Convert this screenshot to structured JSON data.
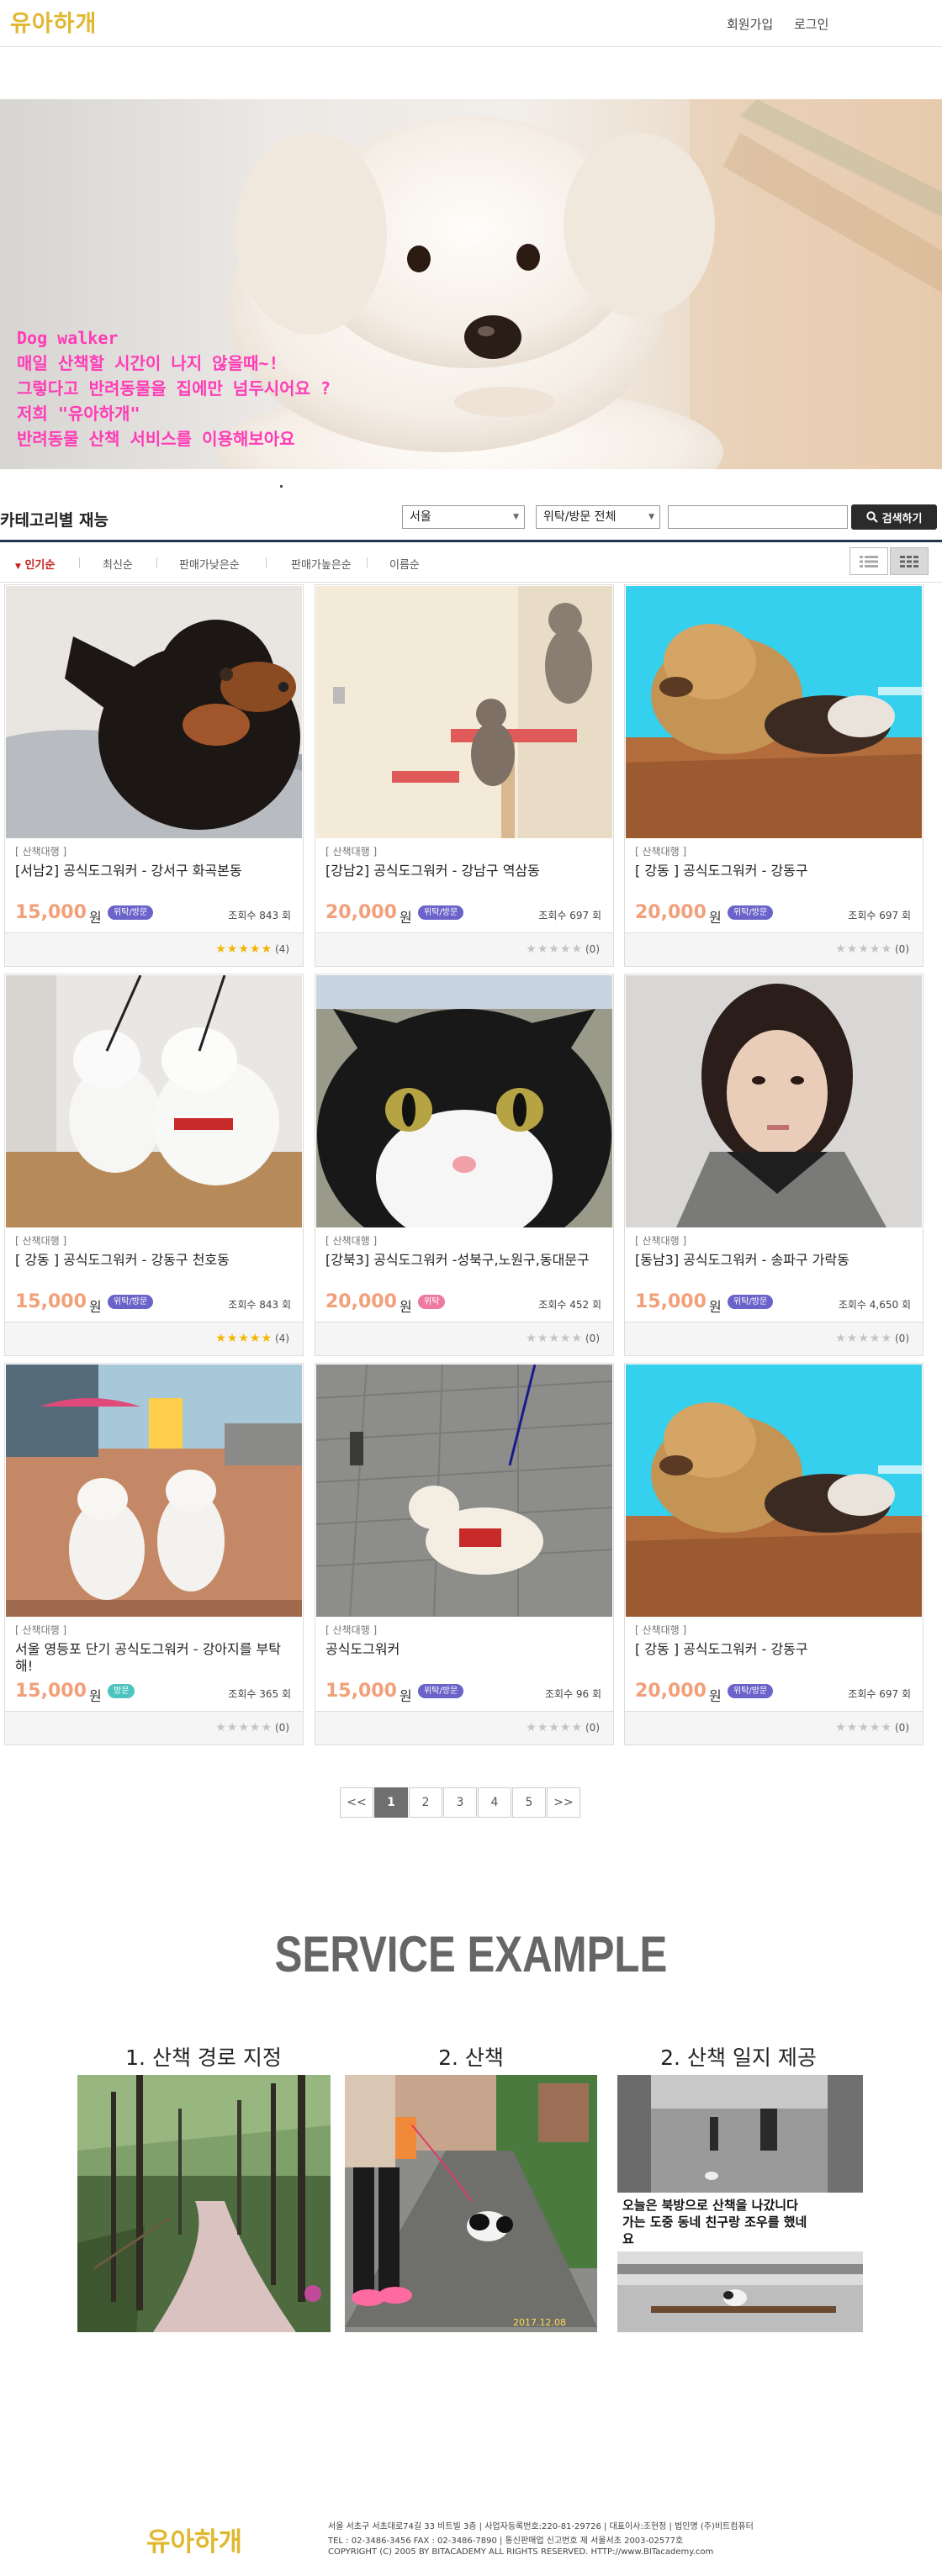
{
  "header": {
    "logo": "유아하개",
    "signup": "회원가입",
    "login": "로그인"
  },
  "hero": {
    "lines": [
      "Dog walker",
      "매일 산책할 시간이 나지 않을때~!",
      "그렇다고 반려동물을 집에만 넘두시어요 ?",
      "저희 \"유아하개\"",
      "반려동물 산책 서비스를 이용해보아요"
    ]
  },
  "category": {
    "title": "카테고리별 재능",
    "region": "서울",
    "type": "위탁/방문 전체",
    "search_placeholder": "",
    "search_button": "검색하기",
    "sorts": [
      "인기순",
      "최신순",
      "판매가낮은순",
      "판매가높은순",
      "이름순"
    ]
  },
  "listings": [
    {
      "tag": "[ 산책대행 ]",
      "title": "[서남2] 공식도그워커 - 강서구 화곡본동",
      "price": "15,000",
      "won": "원",
      "badge": "위탁/방문",
      "views": "조회수 843 회",
      "rating": 5,
      "count": "(4)"
    },
    {
      "tag": "[ 산책대행 ]",
      "title": "[강남2] 공식도그워커 - 강남구 역삼동",
      "price": "20,000",
      "won": "원",
      "badge": "위탁/방문",
      "views": "조회수 697 회",
      "rating": 0,
      "count": "(0)"
    },
    {
      "tag": "[ 산책대행 ]",
      "title": "[ 강동 ]  공식도그워커 -  강동구",
      "price": "20,000",
      "won": "원",
      "badge": "위탁/방문",
      "views": "조회수 697 회",
      "rating": 0,
      "count": "(0)"
    },
    {
      "tag": "[ 산책대행 ]",
      "title": "[ 강동 ]  공식도그워커 - 강동구 천호동",
      "price": "15,000",
      "won": "원",
      "badge": "위탁/방문",
      "views": "조회수 843 회",
      "rating": 5,
      "count": "(4)"
    },
    {
      "tag": "[ 산책대행 ]",
      "title": "[강북3] 공식도그워커 -성북구,노원구,동대문구",
      "price": "20,000",
      "won": "원",
      "badge": "위탁",
      "views": "조회수 452 회",
      "rating": 0,
      "count": "(0)"
    },
    {
      "tag": "[ 산책대행 ]",
      "title": "[동남3] 공식도그워커 - 송파구 가락동",
      "price": "15,000",
      "won": "원",
      "badge": "위탁/방문",
      "views": "조회수 4,650 회",
      "rating": 0,
      "count": "(0)"
    },
    {
      "tag": "[ 산책대행 ]",
      "title": "서울 영등포 단기 공식도그워커 - 강아지를 부탁해!",
      "price": "15,000",
      "won": "원",
      "badge": "방문",
      "views": "조회수 365 회",
      "rating": 0,
      "count": "(0)"
    },
    {
      "tag": "[ 산책대행 ]",
      "title": "공식도그워커",
      "price": "15,000",
      "won": "원",
      "badge": "위탁/방문",
      "views": "조회수 96 회",
      "rating": 0,
      "count": "(0)"
    },
    {
      "tag": "[ 산책대행 ]",
      "title": "[ 강동 ]  공식도그워커 -  강동구",
      "price": "20,000",
      "won": "원",
      "badge": "위탁/방문",
      "views": "조회수 697 회",
      "rating": 0,
      "count": "(0)"
    }
  ],
  "pagination": [
    "<<",
    "1",
    "2",
    "3",
    "4",
    "5",
    ">>"
  ],
  "service": {
    "title": "SERVICE EXAMPLE",
    "items": [
      "1. 산책 경로 지정",
      "2. 산책",
      "2. 산책 일지 제공"
    ],
    "photo2_stamp": "2017.12.08",
    "photo3_caption": [
      "오늘은 북방으로 산책을 나갔니다",
      "가는 도중 동네 친구랑 조우를 했네",
      "요"
    ]
  },
  "footer": {
    "logo": "유아하개",
    "line1": "서울 서초구 서초대로74길 33 비트빌 3층 | 사업자등록번호:220-81-29726 | 대표이사:조현정 | 법인명 (주)비트컴퓨터",
    "line2": "TEL : 02-3486-3456 FAX : 02-3486-7890 | 통신판매업 신고번호 제 서울서초 2003-02577호",
    "line3": "COPYRIGHT (C) 2005 BY BITACADEMY ALL RIGHTS RESERVED. HTTP://www.BITacademy.com"
  },
  "colors": {
    "accent": "#c81e1e",
    "navy": "#24354d",
    "price": "#f2a07a",
    "badge": "#6a63c9",
    "badge_pink": "#ee7aa0",
    "badge_teal": "#4cc4c0",
    "star": "#f4b400",
    "hero_text": "#ff3cb6"
  }
}
